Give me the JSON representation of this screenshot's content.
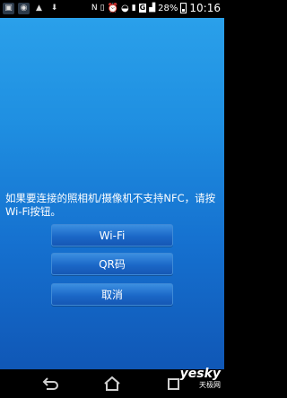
{
  "status_bar": {
    "battery_percent": "28%",
    "time": "10:16",
    "network_badge": "G"
  },
  "dialog": {
    "message": "如果要连接的照相机/摄像机不支持NFC，请按Wi-Fi按钮。",
    "buttons": {
      "wifi": "Wi-Fi",
      "qr": "QR码",
      "cancel": "取消"
    }
  },
  "watermark": {
    "brand": "yesky",
    "sub": "天极网"
  },
  "colors": {
    "background_top": "#2aa0ea",
    "background_bottom": "#1057b6",
    "button": "#1b68c8"
  }
}
